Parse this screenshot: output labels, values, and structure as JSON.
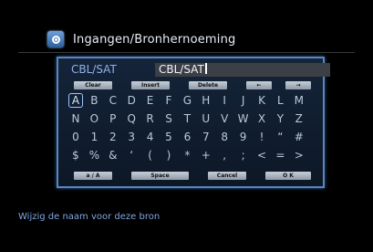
{
  "header": {
    "title": "Ingangen/Bronhernoeming",
    "icon": "source-settings-icon"
  },
  "editor": {
    "source_label": "CBL/SAT",
    "current_name": "CBL/SAT",
    "buttons_top": [
      "Clear",
      "Insert",
      "Delete",
      "←",
      "→"
    ],
    "buttons_bottom": [
      "a / A",
      "Space",
      "Cancel",
      "O K"
    ],
    "selected_key": "A",
    "keys": [
      [
        "A",
        "B",
        "C",
        "D",
        "E",
        "F",
        "G",
        "H",
        "I",
        "J",
        "K",
        "L",
        "M"
      ],
      [
        "N",
        "O",
        "P",
        "Q",
        "R",
        "S",
        "T",
        "U",
        "V",
        "W",
        "X",
        "Y",
        "Z"
      ],
      [
        "0",
        "1",
        "2",
        "3",
        "4",
        "5",
        "6",
        "7",
        "8",
        "9",
        "!",
        "“",
        "#"
      ],
      [
        "$",
        "%",
        "&",
        "‘",
        "(",
        ")",
        "*",
        "+",
        ",",
        ";",
        "<",
        "=",
        ">"
      ]
    ]
  },
  "footer": {
    "help_text": "Wijzig de naam voor deze bron"
  },
  "colors": {
    "accent": "#5a86bd",
    "text": "#b8c8dc",
    "help": "#7fa6e0"
  }
}
